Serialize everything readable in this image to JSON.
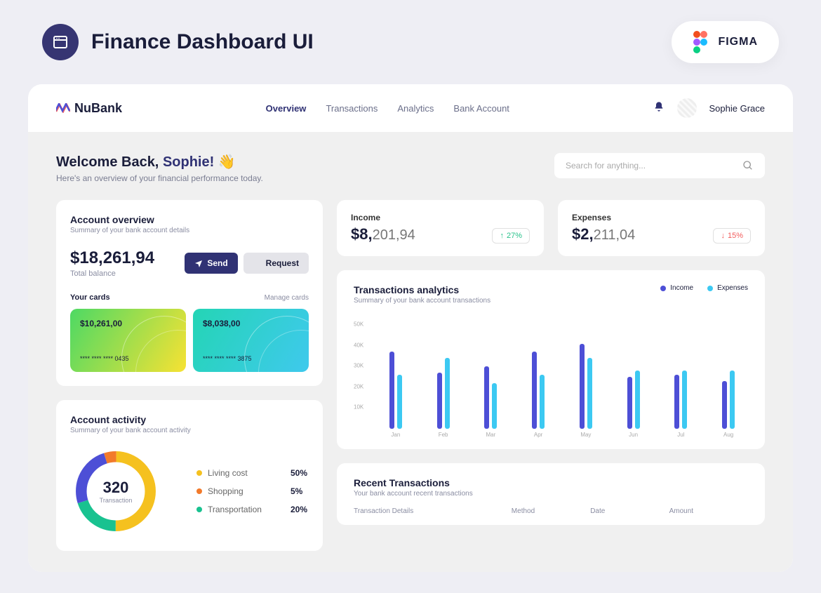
{
  "page": {
    "title": "Finance Dashboard UI",
    "figma_label": "FIGMA"
  },
  "brand": {
    "name": "NuBank"
  },
  "nav": {
    "items": [
      {
        "label": "Overview",
        "active": true
      },
      {
        "label": "Transactions",
        "active": false
      },
      {
        "label": "Analytics",
        "active": false
      },
      {
        "label": "Bank Account",
        "active": false
      }
    ]
  },
  "user": {
    "name": "Sophie Grace"
  },
  "welcome": {
    "prefix": "Welcome Back, ",
    "name": "Sophie!",
    "emoji": "👋",
    "sub": "Here's an overview of your financial performance today."
  },
  "search": {
    "placeholder": "Search for anything..."
  },
  "overview": {
    "title": "Account overview",
    "sub": "Summary of your bank account details",
    "balance_value": "$18,261,94",
    "balance_label": "Total balance",
    "send_label": "Send",
    "request_label": "Request",
    "cards_label": "Your cards",
    "manage_label": "Manage cards",
    "cards": [
      {
        "amount": "$10,261,00",
        "num": "**** **** **** 0435"
      },
      {
        "amount": "$8,038,00",
        "num": "**** **** **** 3875"
      }
    ]
  },
  "income": {
    "label": "Income",
    "value_bold": "$8,",
    "value_rest": "201,94",
    "change": "27%",
    "dir": "up"
  },
  "expenses": {
    "label": "Expenses",
    "value_bold": "$2,",
    "value_rest": "211,04",
    "change": "15%",
    "dir": "down"
  },
  "analytics": {
    "title": "Transactions analytics",
    "sub": "Summary of your bank account transactions",
    "legend_income": "Income",
    "legend_expenses": "Expenses",
    "colors": {
      "income": "#4d4fd6",
      "expenses": "#3cc9f2"
    }
  },
  "activity": {
    "title": "Account activity",
    "sub": "Summary of your bank account activity",
    "center_value": "320",
    "center_label": "Transaction",
    "items": [
      {
        "name": "Living cost",
        "pct": "50%",
        "color": "#f5c11f"
      },
      {
        "name": "Shopping",
        "pct": "5%",
        "color": "#f27a2b"
      },
      {
        "name": "Transportation",
        "pct": "20%",
        "color": "#19c290"
      }
    ]
  },
  "recent": {
    "title": "Recent Transactions",
    "sub": "Your bank account recent transactions",
    "columns": [
      "Transaction Details",
      "Method",
      "Date",
      "Amount"
    ]
  },
  "chart_data": {
    "type": "bar",
    "title": "Transactions analytics",
    "xlabel": "",
    "ylabel": "",
    "ylim": [
      0,
      50000
    ],
    "yticks": [
      "50K",
      "40K",
      "30K",
      "20K",
      "10K"
    ],
    "categories": [
      "Jan",
      "Feb",
      "Mar",
      "Apr",
      "May",
      "Jun",
      "Jul",
      "Aug"
    ],
    "series": [
      {
        "name": "Income",
        "color": "#4d4fd6",
        "values": [
          37000,
          27000,
          30000,
          37000,
          41000,
          25000,
          26000,
          23000
        ]
      },
      {
        "name": "Expenses",
        "color": "#3cc9f2",
        "values": [
          26000,
          34000,
          22000,
          26000,
          34000,
          28000,
          28000,
          28000
        ]
      }
    ]
  }
}
